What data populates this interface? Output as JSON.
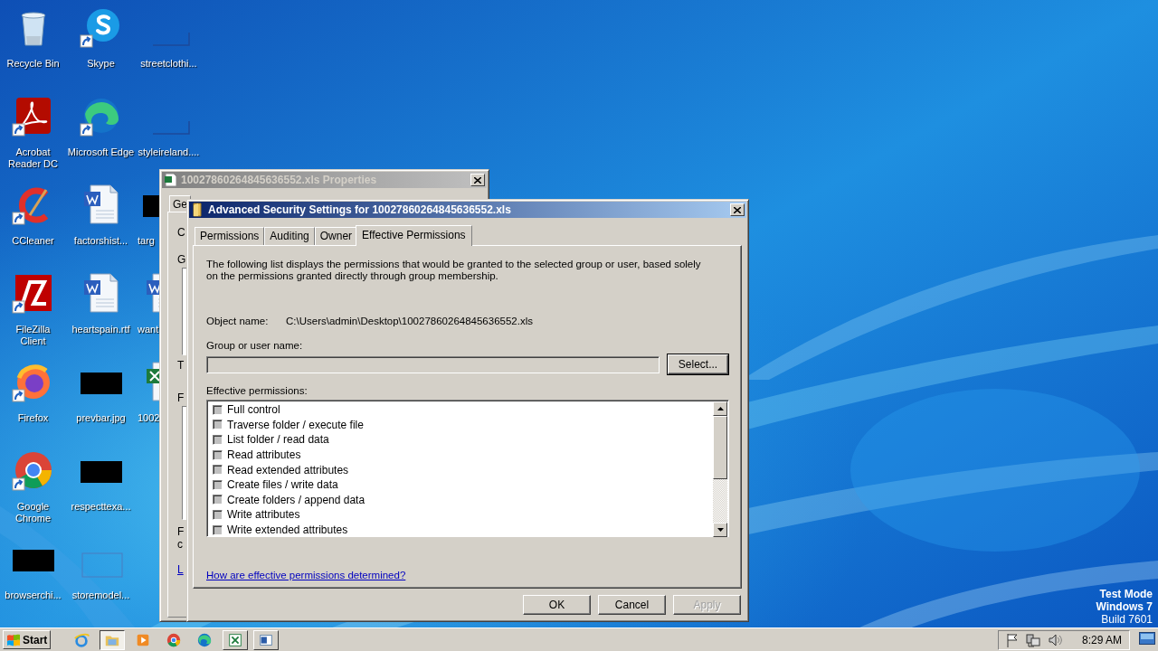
{
  "desktop_icons": [
    {
      "label": "Recycle Bin",
      "kind": "recycle",
      "shortcut": false,
      "partly_hidden": false
    },
    {
      "label": "Acrobat Reader DC",
      "kind": "acrobat",
      "shortcut": true,
      "partly_hidden": false
    },
    {
      "label": "CCleaner",
      "kind": "ccleaner",
      "shortcut": true,
      "partly_hidden": false
    },
    {
      "label": "FileZilla Client",
      "kind": "filezilla",
      "shortcut": true,
      "partly_hidden": false
    },
    {
      "label": "Firefox",
      "kind": "firefox",
      "shortcut": true,
      "partly_hidden": false
    },
    {
      "label": "Google Chrome",
      "kind": "chrome",
      "shortcut": true,
      "partly_hidden": false
    },
    {
      "label": "browserchi...",
      "kind": "black",
      "shortcut": false,
      "partly_hidden": false
    },
    {
      "label": "Skype",
      "kind": "skype",
      "shortcut": true,
      "partly_hidden": false
    },
    {
      "label": "Microsoft Edge",
      "kind": "edge",
      "shortcut": true,
      "partly_hidden": false
    },
    {
      "label": "factorshist...",
      "kind": "word",
      "shortcut": false,
      "partly_hidden": false
    },
    {
      "label": "heartspain.rtf",
      "kind": "word",
      "shortcut": false,
      "partly_hidden": false
    },
    {
      "label": "prevbar.jpg",
      "kind": "black",
      "shortcut": false,
      "partly_hidden": false
    },
    {
      "label": "respecttexa...",
      "kind": "black",
      "shortcut": false,
      "partly_hidden": false
    },
    {
      "label": "storemodel...",
      "kind": "frame",
      "shortcut": false,
      "partly_hidden": false
    },
    {
      "label": "streetclothi...",
      "kind": "blank",
      "shortcut": false,
      "partly_hidden": false
    },
    {
      "label": "styleireland....",
      "kind": "blank",
      "shortcut": false,
      "partly_hidden": false
    },
    {
      "label": "targ",
      "kind": "black",
      "shortcut": false,
      "partly_hidden": true
    },
    {
      "label": "want",
      "kind": "word",
      "shortcut": false,
      "partly_hidden": true
    },
    {
      "label": "1002",
      "kind": "excel",
      "shortcut": false,
      "partly_hidden": true
    }
  ],
  "properties_window": {
    "title": "10027860264845636552.xls Properties",
    "active": false,
    "tab": "Ge",
    "fragments": [
      "C",
      "G",
      "T",
      "F",
      "F",
      "c",
      "L"
    ]
  },
  "dialog": {
    "title": "Advanced Security Settings for 10027860264845636552.xls",
    "active": true,
    "tabs": [
      {
        "label": "Permissions",
        "selected": false
      },
      {
        "label": "Auditing",
        "selected": false
      },
      {
        "label": "Owner",
        "selected": false
      },
      {
        "label": "Effective Permissions",
        "selected": true
      }
    ],
    "description": "The following list displays the permissions that would be granted to the selected group or user, based solely on the permissions granted directly through group membership.",
    "object_name_label": "Object name:",
    "object_name": "C:\\Users\\admin\\Desktop\\10027860264845636552.xls",
    "group_label": "Group or user name:",
    "select_button": "Select...",
    "permissions_label": "Effective permissions:",
    "permissions": [
      {
        "label": "Full control",
        "checked": false
      },
      {
        "label": "Traverse folder / execute file",
        "checked": false
      },
      {
        "label": "List folder / read data",
        "checked": false
      },
      {
        "label": "Read attributes",
        "checked": false
      },
      {
        "label": "Read extended attributes",
        "checked": false
      },
      {
        "label": "Create files / write data",
        "checked": false
      },
      {
        "label": "Create folders / append data",
        "checked": false
      },
      {
        "label": "Write attributes",
        "checked": false
      },
      {
        "label": "Write extended attributes",
        "checked": false
      }
    ],
    "link": "How are effective permissions determined?",
    "buttons": [
      {
        "label": "OK",
        "disabled": false
      },
      {
        "label": "Cancel",
        "disabled": false
      },
      {
        "label": "Apply",
        "disabled": true
      }
    ]
  },
  "test_mode": {
    "lines": [
      "Test Mode",
      "Windows 7"
    ],
    "build": "Build 7601"
  },
  "taskbar": {
    "start": "Start",
    "apps": [
      {
        "kind": "ie",
        "active": false,
        "running": false
      },
      {
        "kind": "explorer",
        "active": true,
        "running": false
      },
      {
        "kind": "media",
        "active": false,
        "running": false
      },
      {
        "kind": "chrome",
        "active": false,
        "running": false
      },
      {
        "kind": "edge",
        "active": false,
        "running": false
      },
      {
        "kind": "excel",
        "active": false,
        "running": true
      },
      {
        "kind": "window",
        "active": false,
        "running": true
      }
    ],
    "clock": "8:29 AM"
  }
}
